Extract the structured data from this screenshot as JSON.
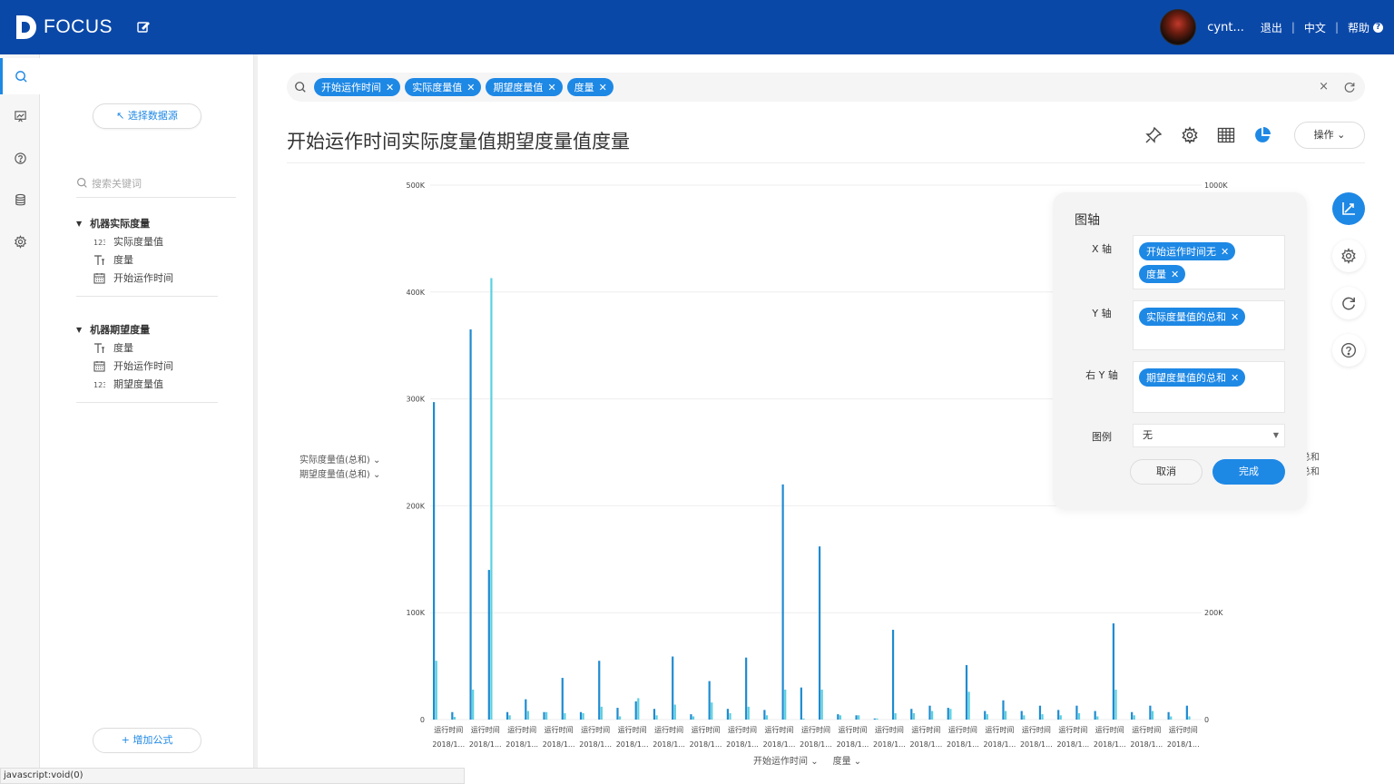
{
  "header": {
    "logo_text": "FOCUS",
    "username": "cynt...",
    "logout": "退出",
    "language": "中文",
    "help": "帮助",
    "help_glyph": "?",
    "brand_color": "#0a48a8"
  },
  "sidebar_icons": [
    "search-icon",
    "board-icon",
    "question-icon",
    "database-icon",
    "settings-icon"
  ],
  "left_panel": {
    "select_datasource": "↖ 选择数据源",
    "search_placeholder": "搜索关键词",
    "groups": [
      {
        "title": "机器实际度量",
        "items": [
          {
            "label": "实际度量值",
            "icon": "number-measure-icon"
          },
          {
            "label": "度量",
            "icon": "text-attribute-icon"
          },
          {
            "label": "开始运作时间",
            "icon": "calendar-icon"
          }
        ]
      },
      {
        "title": "机器期望度量",
        "items": [
          {
            "label": "度量",
            "icon": "text-attribute-icon"
          },
          {
            "label": "开始运作时间",
            "icon": "calendar-icon"
          },
          {
            "label": "期望度量值",
            "icon": "number-measure-icon"
          }
        ]
      }
    ],
    "add_formula": "+ 增加公式"
  },
  "search": {
    "tags": [
      "开始运作时间",
      "实际度量值",
      "期望度量值",
      "度量"
    ],
    "clear_glyph": "×"
  },
  "title": "开始运作时间实际度量值期望度量值度量",
  "operate_button": "操作",
  "legend_left": [
    "实际度量值(总和)",
    "期望度量值(总和)"
  ],
  "legend_right_fragments": [
    "总和",
    "总和"
  ],
  "x_axis_titles": [
    "开始运作时间",
    "度量"
  ],
  "axis_popup": {
    "title": "图轴",
    "x_label": "X 轴",
    "x_tags": [
      "开始运作时间无",
      "度量"
    ],
    "y_label": "Y 轴",
    "y_tags": [
      "实际度量值的总和"
    ],
    "ry_label": "右 Y 轴",
    "ry_tags": [
      "期望度量值的总和"
    ],
    "legend_label": "图例",
    "legend_value": "无",
    "cancel": "取消",
    "done": "完成"
  },
  "status_bar": "javascript:void(0)",
  "chart_data": {
    "type": "bar",
    "y_ticks": [
      "0",
      "100K",
      "200K",
      "300K",
      "400K",
      "500K"
    ],
    "ylim": [
      0,
      500000
    ],
    "y2_ticks": [
      "0",
      "200K",
      "1000K"
    ],
    "y2lim": [
      0,
      1000000
    ],
    "category_line1": "运行时间",
    "category_line2": "2018/1...",
    "series": [
      {
        "name": "实际度量值(总和)",
        "color": "#1f8bd0",
        "axis": "left",
        "values": [
          297000,
          7000,
          365000,
          140000,
          7000,
          19000,
          7000,
          39000,
          7000,
          55000,
          11000,
          17000,
          10000,
          59000,
          5000,
          36000,
          10000,
          58000,
          9000,
          220000,
          30000,
          162000,
          5000,
          4000,
          1000,
          84000,
          10000,
          13000,
          11000,
          51000,
          8000,
          18000,
          8000,
          13000,
          9000,
          13000,
          8000,
          90000,
          7000,
          13000,
          7000,
          13000
        ]
      },
      {
        "name": "期望度量值(总和)",
        "color": "#5bd0df",
        "axis": "right",
        "values": [
          110000,
          5000,
          56000,
          826000,
          8000,
          16000,
          14000,
          12000,
          12000,
          24000,
          6000,
          40000,
          8000,
          28000,
          6000,
          32000,
          12000,
          24000,
          8000,
          56000,
          2000,
          56000,
          8000,
          8000,
          2000,
          12000,
          12000,
          16000,
          20000,
          52000,
          10000,
          16000,
          8000,
          10000,
          8000,
          12000,
          6000,
          56000,
          8000,
          16000,
          6000,
          6000
        ]
      }
    ]
  }
}
